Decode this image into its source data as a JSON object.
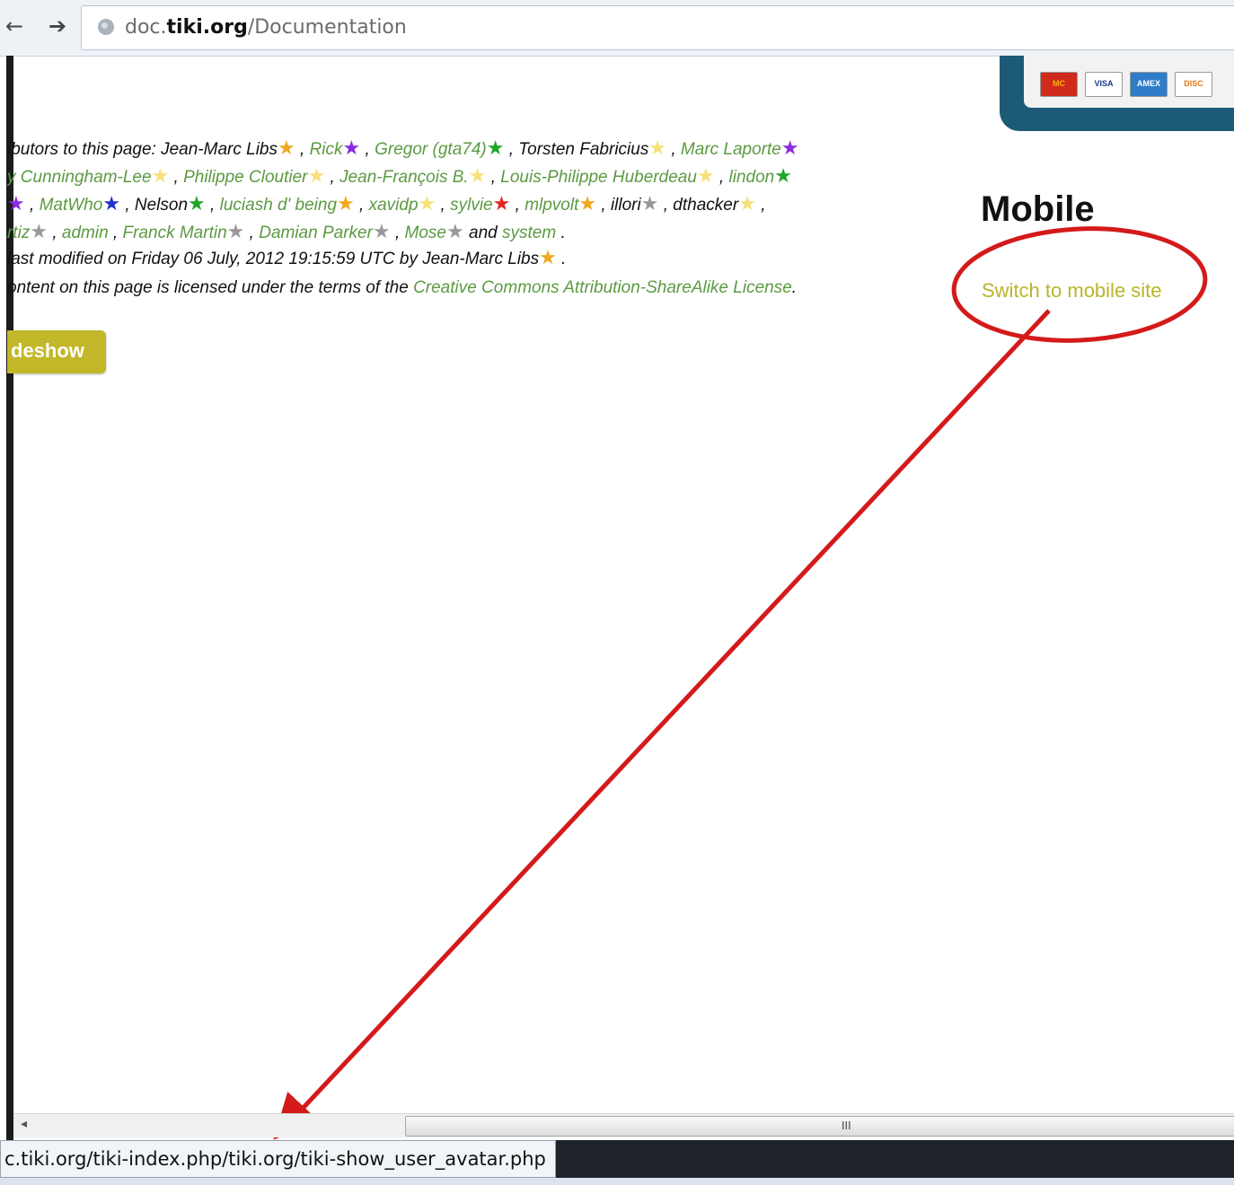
{
  "browser": {
    "back_icon": "←",
    "forward_icon": "➔",
    "url_prefix": "doc.",
    "url_domain": "tiki.org",
    "url_path": "/Documentation"
  },
  "payment_cards": [
    "MC",
    "VISA",
    "AMEX",
    "DISC"
  ],
  "contributors": {
    "lines": [
      [
        {
          "t": "ibutors to this page: Jean-Marc Libs",
          "k": "blk"
        },
        {
          "t": "★",
          "k": "star",
          "c": "#f0a81e"
        },
        {
          "t": " , ",
          "k": "blk"
        },
        {
          "t": "Rick",
          "k": "link"
        },
        {
          "t": "★",
          "k": "star",
          "c": "#8a2be2"
        },
        {
          "t": " , ",
          "k": "blk"
        },
        {
          "t": "Gregor (gta74)",
          "k": "link"
        },
        {
          "t": "★",
          "k": "star",
          "c": "#1fa52a"
        },
        {
          "t": " , Torsten Fabricius",
          "k": "blk"
        },
        {
          "t": "★",
          "k": "star",
          "c": "#f7e07a"
        },
        {
          "t": " , ",
          "k": "blk"
        },
        {
          "t": "Marc Laporte",
          "k": "link"
        },
        {
          "t": "★",
          "k": "star",
          "c": "#8a2be2"
        }
      ],
      [
        {
          "t": "y Cunningham-Lee",
          "k": "link"
        },
        {
          "t": "★",
          "k": "star",
          "c": "#f7e07a"
        },
        {
          "t": " , ",
          "k": "blk"
        },
        {
          "t": "Philippe Cloutier",
          "k": "link"
        },
        {
          "t": "★",
          "k": "star",
          "c": "#f7e07a"
        },
        {
          "t": " , ",
          "k": "blk"
        },
        {
          "t": "Jean-François B.",
          "k": "link"
        },
        {
          "t": "★",
          "k": "star",
          "c": "#f7e07a"
        },
        {
          "t": " , ",
          "k": "blk"
        },
        {
          "t": "Louis-Philippe Huberdeau",
          "k": "link"
        },
        {
          "t": "★",
          "k": "star",
          "c": "#f7e07a"
        },
        {
          "t": " , ",
          "k": "blk"
        },
        {
          "t": "lindon",
          "k": "link"
        },
        {
          "t": "★",
          "k": "star",
          "c": "#1fa52a"
        }
      ],
      [
        {
          "t": "★",
          "k": "star",
          "c": "#8a2be2"
        },
        {
          "t": " , ",
          "k": "blk"
        },
        {
          "t": "MatWho",
          "k": "link"
        },
        {
          "t": "★",
          "k": "star",
          "c": "#2233cc"
        },
        {
          "t": " , Nelson",
          "k": "blk"
        },
        {
          "t": "★",
          "k": "star",
          "c": "#1fa52a"
        },
        {
          "t": " , ",
          "k": "blk"
        },
        {
          "t": "luciash d' being",
          "k": "link"
        },
        {
          "t": "★",
          "k": "star",
          "c": "#f0a81e"
        },
        {
          "t": " , ",
          "k": "blk"
        },
        {
          "t": "xavidp",
          "k": "link"
        },
        {
          "t": "★",
          "k": "star",
          "c": "#f7e07a"
        },
        {
          "t": " , ",
          "k": "blk"
        },
        {
          "t": "sylvie",
          "k": "link"
        },
        {
          "t": "★",
          "k": "star",
          "c": "#e02626"
        },
        {
          "t": " , ",
          "k": "blk"
        },
        {
          "t": "mlpvolt",
          "k": "link"
        },
        {
          "t": "★",
          "k": "star",
          "c": "#f0a81e"
        },
        {
          "t": " , illori",
          "k": "blk"
        },
        {
          "t": "★",
          "k": "star",
          "c": "#999999"
        },
        {
          "t": " , dthacker",
          "k": "blk"
        },
        {
          "t": "★",
          "k": "star",
          "c": "#f7e07a"
        },
        {
          "t": " ,",
          "k": "blk"
        }
      ],
      [
        {
          "t": "rtiz",
          "k": "link"
        },
        {
          "t": "★",
          "k": "star",
          "c": "#999999"
        },
        {
          "t": " , ",
          "k": "blk"
        },
        {
          "t": "admin",
          "k": "link"
        },
        {
          "t": " , ",
          "k": "blk"
        },
        {
          "t": "Franck Martin",
          "k": "link"
        },
        {
          "t": "★",
          "k": "star",
          "c": "#999999"
        },
        {
          "t": " , ",
          "k": "blk"
        },
        {
          "t": "Damian Parker",
          "k": "link"
        },
        {
          "t": "★",
          "k": "star",
          "c": "#999999"
        },
        {
          "t": " , ",
          "k": "blk"
        },
        {
          "t": "Mose",
          "k": "link"
        },
        {
          "t": "★",
          "k": "star",
          "c": "#999999"
        },
        {
          "t": " and ",
          "k": "blk"
        },
        {
          "t": "system",
          "k": "link"
        },
        {
          "t": " .",
          "k": "blk"
        }
      ]
    ]
  },
  "last_modified": {
    "text": "last modified on Friday 06 July, 2012 19:15:59 UTC by Jean-Marc Libs",
    "star_color": "#f0a81e",
    "suffix": " ."
  },
  "license": {
    "prefix": "ontent on this page is licensed under the terms of the ",
    "link": "Creative Commons Attribution-ShareAlike License",
    "suffix": "."
  },
  "slideshow_button": "deshow",
  "mobile": {
    "heading": "Mobile",
    "link": "Switch to mobile site"
  },
  "scrollbar": {
    "left_arrow": "◂",
    "grip": "III"
  },
  "status_url": "c.tiki.org/tiki-index.php/tiki.org/tiki-show_user_avatar.php",
  "colors": {
    "link_green": "#5b9a42",
    "mobile_link": "#b8b52a",
    "button_olive": "#c2b82a",
    "annotation_red": "#d41a1a"
  }
}
